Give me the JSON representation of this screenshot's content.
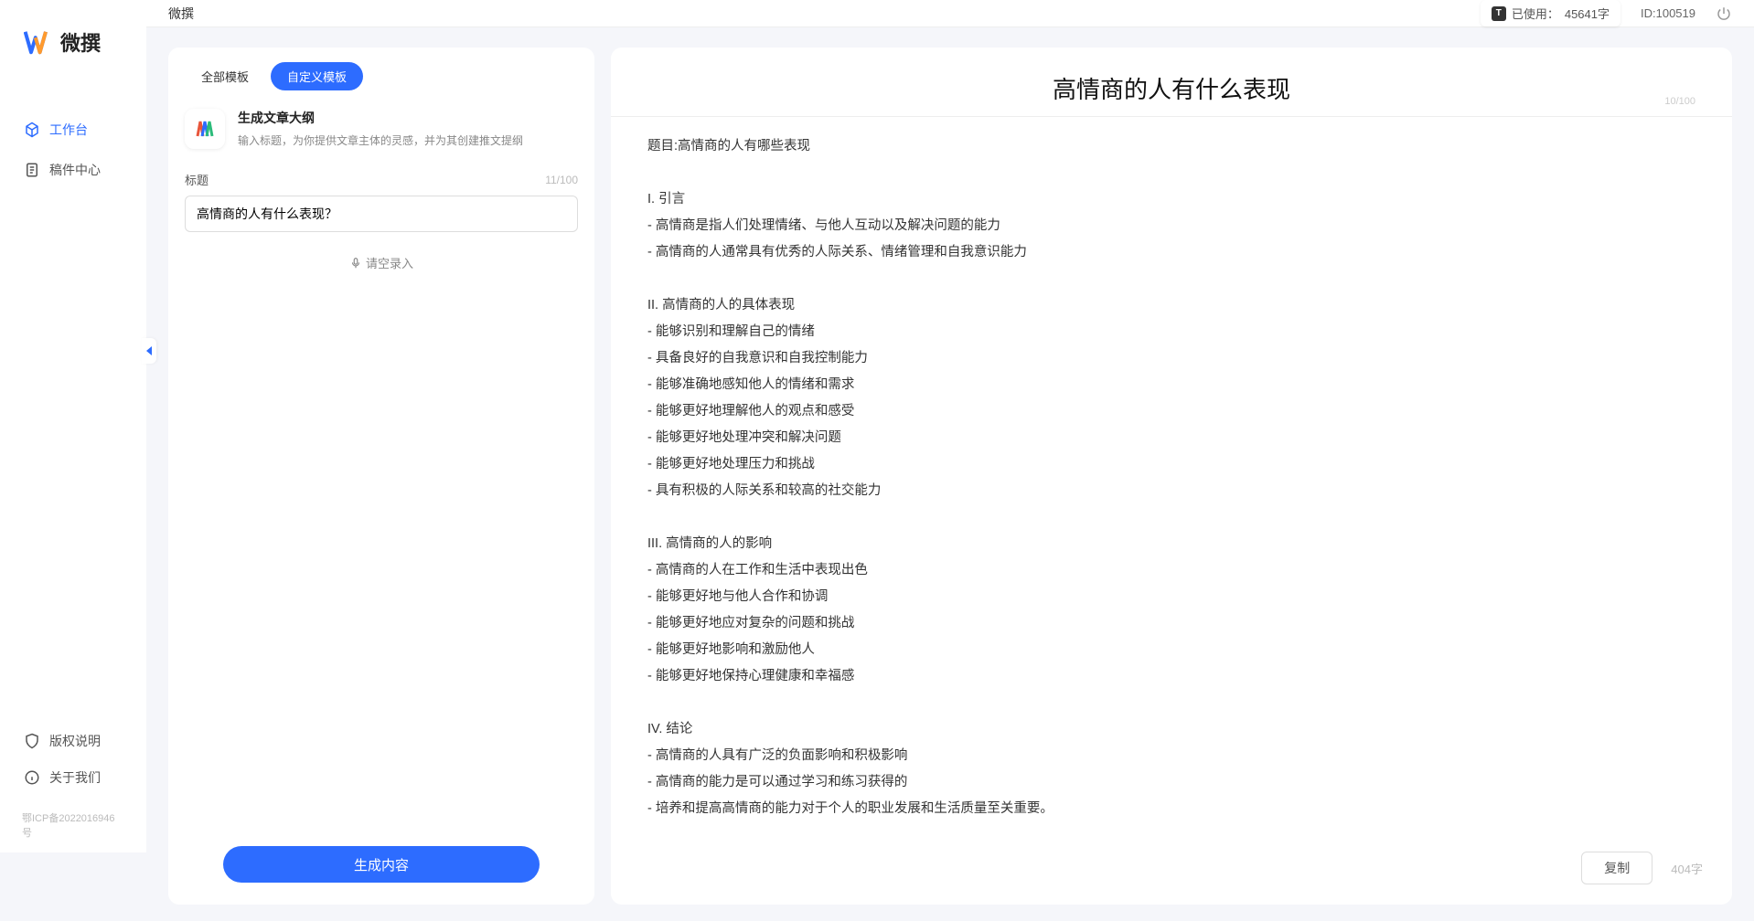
{
  "brand": {
    "name": "微撰"
  },
  "nav": {
    "workspace": "工作台",
    "drafts": "稿件中心",
    "copyright": "版权说明",
    "about": "关于我们"
  },
  "icp": "鄂ICP备2022016946号",
  "topbar": {
    "title": "微撰",
    "usage_prefix": "已使用：",
    "usage_value": "45641字",
    "id_label": "ID:100519"
  },
  "tabs": {
    "all": "全部模板",
    "custom": "自定义模板"
  },
  "template": {
    "name": "生成文章大纲",
    "desc": "输入标题，为你提供文章主体的灵感，并为其创建推文提纲"
  },
  "form": {
    "title_label": "标题",
    "title_count": "11/100",
    "title_value": "高情商的人有什么表现？",
    "voice": "请空录入",
    "generate": "生成内容"
  },
  "output": {
    "title": "高情商的人有什么表现",
    "title_count": "10/100",
    "body": "题目:高情商的人有哪些表现\n\nI. 引言\n- 高情商是指人们处理情绪、与他人互动以及解决问题的能力\n- 高情商的人通常具有优秀的人际关系、情绪管理和自我意识能力\n\nII. 高情商的人的具体表现\n- 能够识别和理解自己的情绪\n- 具备良好的自我意识和自我控制能力\n- 能够准确地感知他人的情绪和需求\n- 能够更好地理解他人的观点和感受\n- 能够更好地处理冲突和解决问题\n- 能够更好地处理压力和挑战\n- 具有积极的人际关系和较高的社交能力\n\nIII. 高情商的人的影响\n- 高情商的人在工作和生活中表现出色\n- 能够更好地与他人合作和协调\n- 能够更好地应对复杂的问题和挑战\n- 能够更好地影响和激励他人\n- 能够更好地保持心理健康和幸福感\n\nIV. 结论\n- 高情商的人具有广泛的负面影响和积极影响\n- 高情商的能力是可以通过学习和练习获得的\n- 培养和提高高情商的能力对于个人的职业发展和生活质量至关重要。",
    "copy": "复制",
    "word_count": "404字"
  }
}
